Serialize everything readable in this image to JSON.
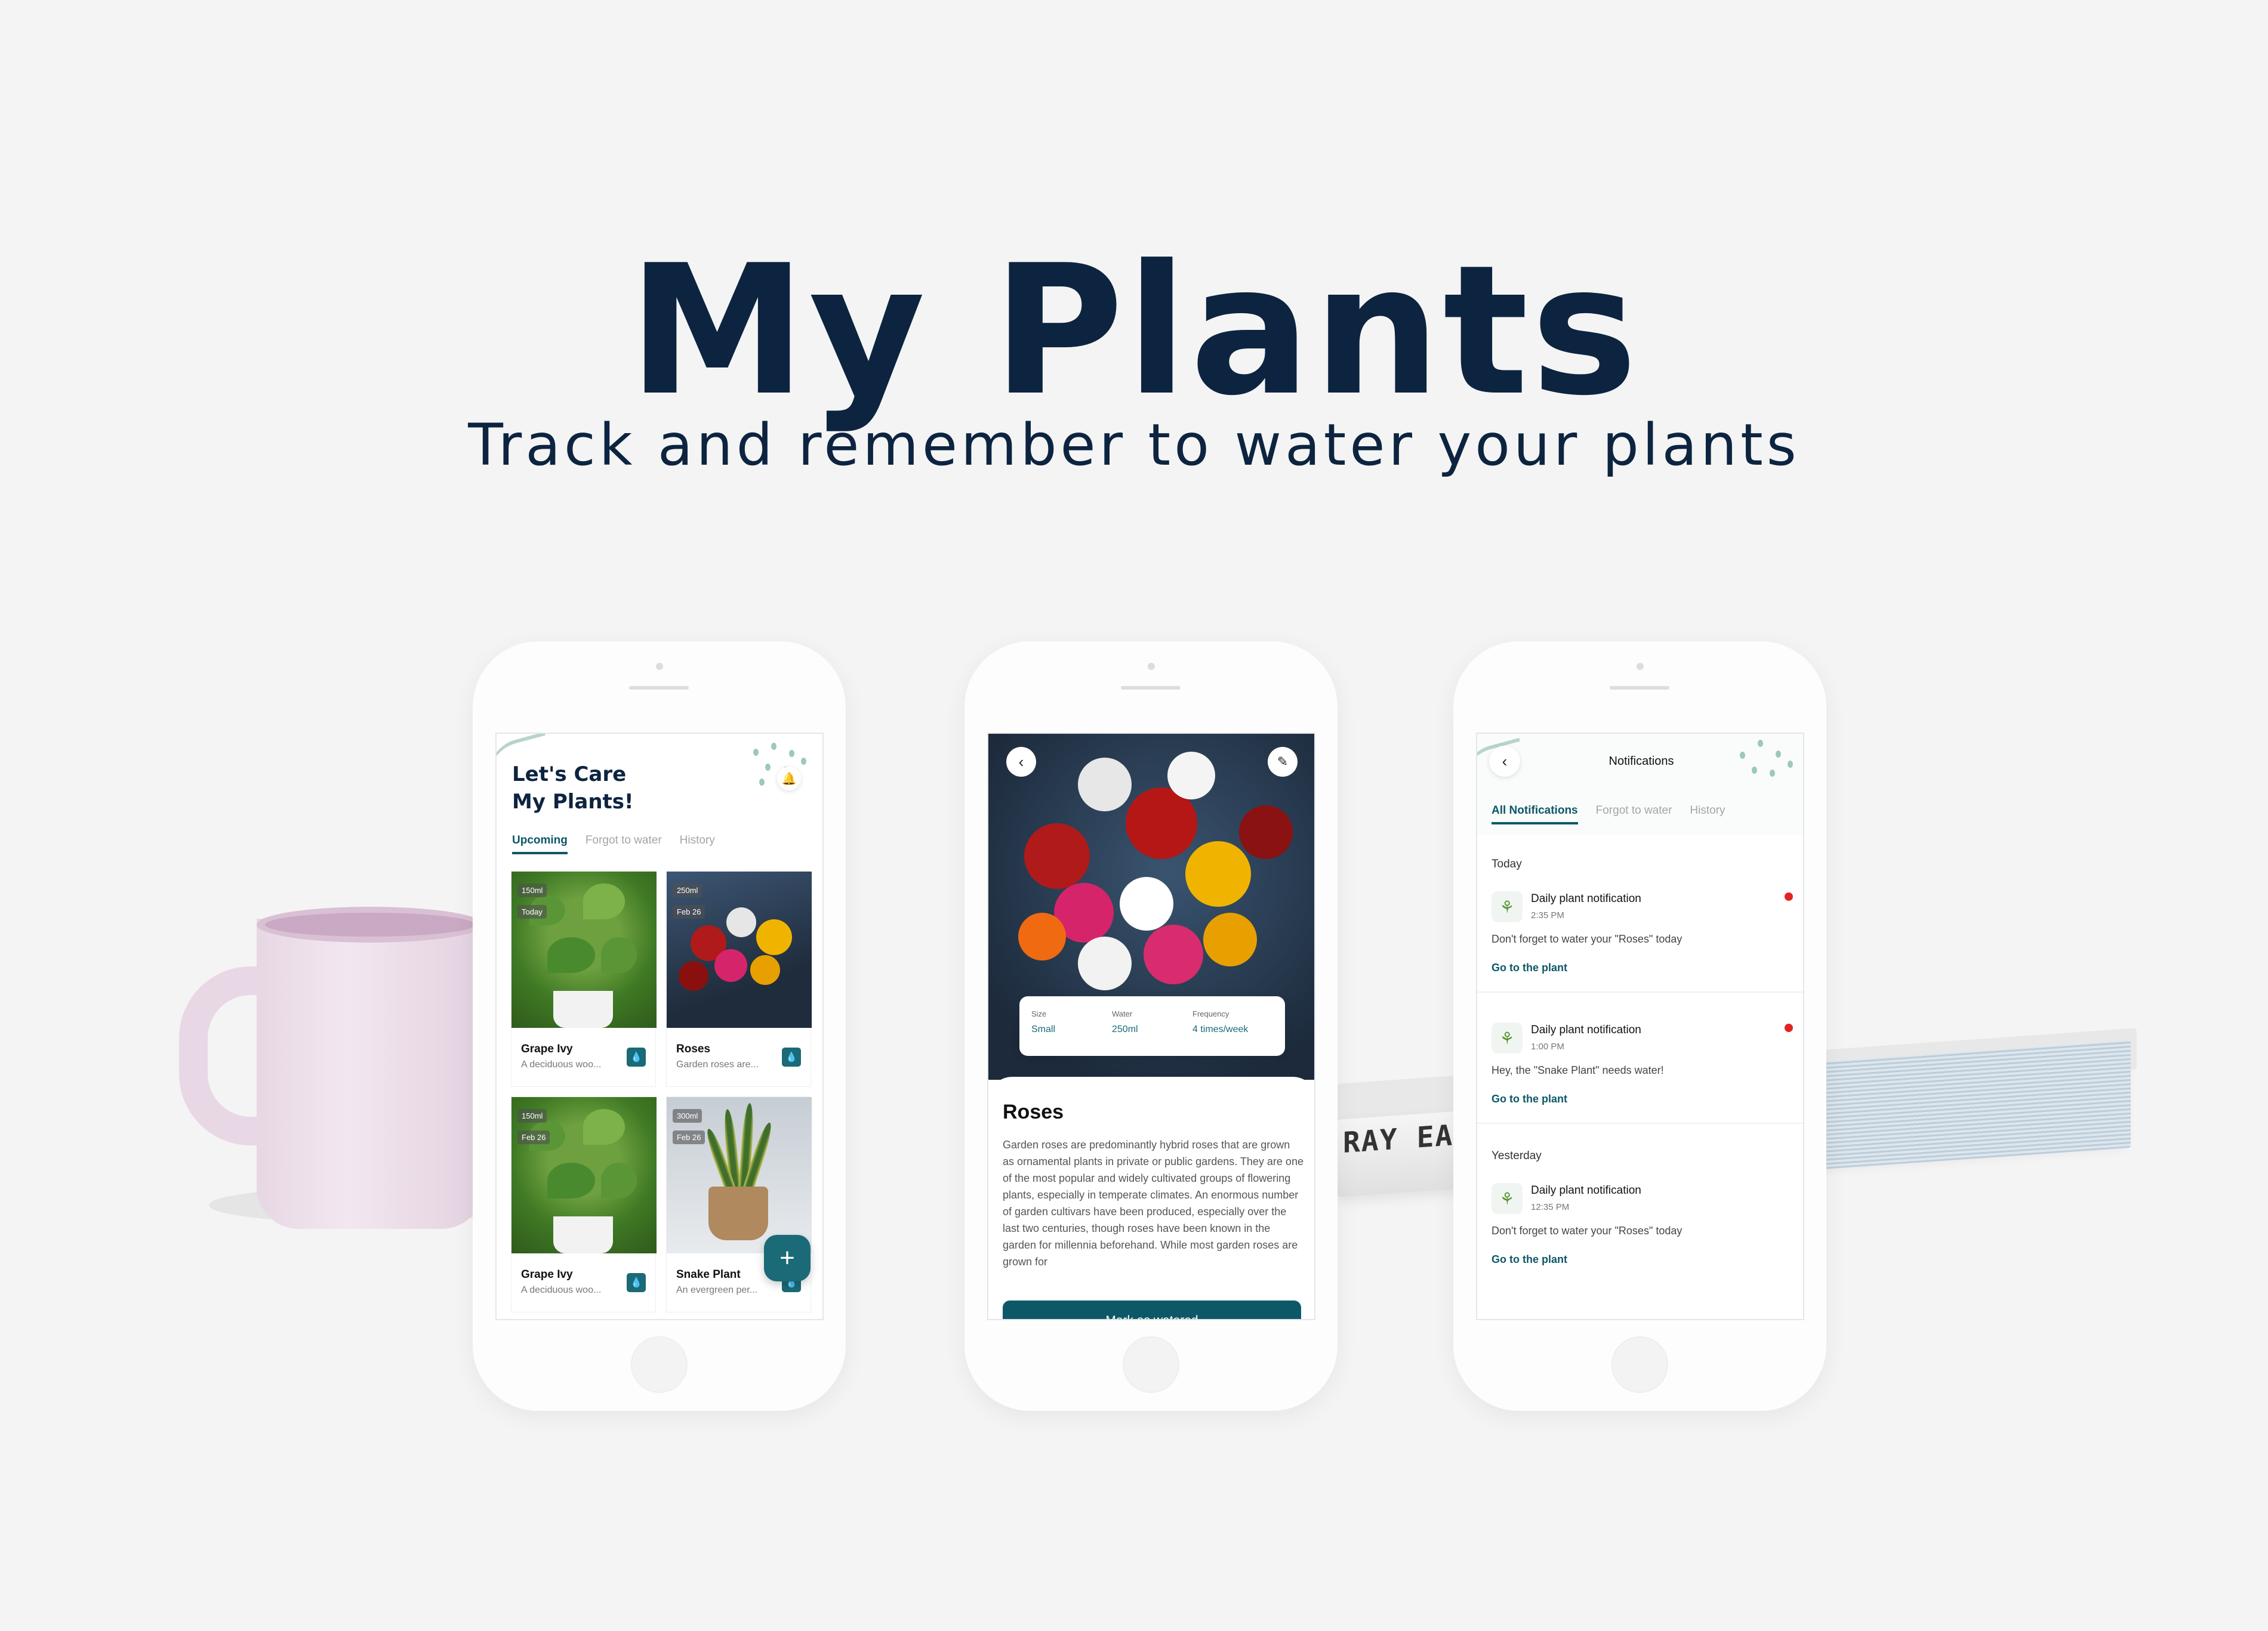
{
  "hero": {
    "title": "My Plants",
    "subtitle": "Track and remember to water your plants"
  },
  "props": {
    "book_spine": "RAY EAMES"
  },
  "screen1": {
    "title_line1": "Let's Care",
    "title_line2": "My Plants!",
    "tabs": [
      {
        "label": "Upcoming",
        "active": true
      },
      {
        "label": "Forgot to water",
        "active": false
      },
      {
        "label": "History",
        "active": false
      }
    ],
    "cards": [
      {
        "name": "Grape Ivy",
        "desc": "A deciduous woo...",
        "amount": "150ml",
        "date": "Today"
      },
      {
        "name": "Roses",
        "desc": "Garden roses are...",
        "amount": "250ml",
        "date": "Feb 26"
      },
      {
        "name": "Grape Ivy",
        "desc": "A deciduous woo...",
        "amount": "150ml",
        "date": "Feb 26"
      },
      {
        "name": "Snake Plant",
        "desc": "An evergreen per...",
        "amount": "300ml",
        "date": "Feb 26"
      }
    ],
    "fab": "+"
  },
  "screen2": {
    "info": [
      {
        "key": "Size",
        "value": "Small"
      },
      {
        "key": "Water",
        "value": "250ml"
      },
      {
        "key": "Frequency",
        "value": "4 times/week"
      }
    ],
    "title": "Roses",
    "description": "Garden roses are predominantly hybrid roses that are grown as ornamental plants in private or public gardens. They are one of the most popular and widely cultivated groups of flowering plants, especially in temperate climates. An enormous number of garden cultivars have been produced, especially over the last two centuries, though roses have been known in the garden for millennia beforehand. While most garden roses are grown for",
    "cta": "Mark as watered"
  },
  "screen3": {
    "title": "Notifications",
    "tabs": [
      {
        "label": "All Notifications",
        "active": true
      },
      {
        "label": "Forgot to water",
        "active": false
      },
      {
        "label": "History",
        "active": false
      }
    ],
    "today_label": "Today",
    "yesterday_label": "Yesterday",
    "notifications": [
      {
        "title": "Daily plant notification",
        "time": "2:35 PM",
        "message": "Don't forget to water your \"Roses\" today",
        "link": "Go to the plant",
        "unread": true
      },
      {
        "title": "Daily plant notification",
        "time": "1:00 PM",
        "message": "Hey, the \"Snake Plant\" needs water!",
        "link": "Go to the plant",
        "unread": true
      },
      {
        "title": "Daily plant notification",
        "time": "12:35 PM",
        "message": "Don't forget to water your \"Roses\" today",
        "link": "Go to the plant",
        "unread": false
      }
    ]
  },
  "colors": {
    "primary": "#0d5868",
    "accent": "#1a6a77",
    "heading": "#0d2440",
    "unread": "#e52222"
  },
  "icons": {
    "bell": "bell-icon",
    "back": "chevron-left-icon",
    "edit": "pencil-icon",
    "water": "water-drop-icon",
    "plant": "plant-icon"
  }
}
